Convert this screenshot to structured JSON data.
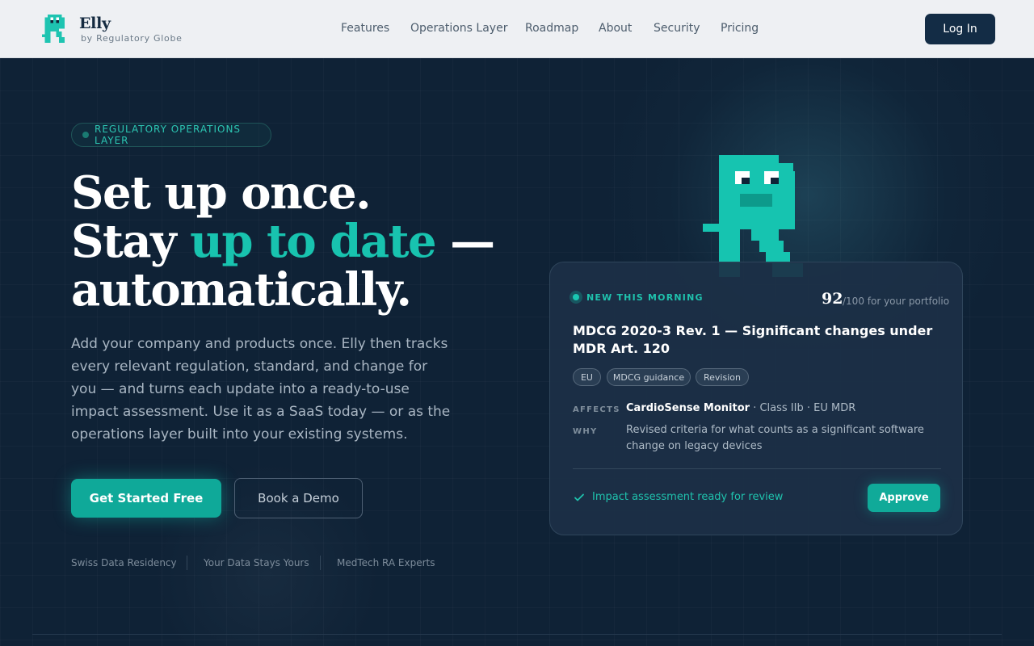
{
  "brand": {
    "name": "Elly",
    "tagline": "by Regulatory Globe",
    "accent_color": "#18c3af"
  },
  "nav": {
    "items": [
      "Features",
      "Operations Layer",
      "Roadmap",
      "About",
      "Security",
      "Pricing"
    ],
    "login_label": "Log In"
  },
  "hero": {
    "badge": "REGULATORY OPERATIONS LAYER",
    "headline_line1": "Set up once.",
    "headline_line2_pre": "Stay ",
    "headline_line2_accent": "up to date",
    "headline_line2_post": " —",
    "headline_line3": "automatically.",
    "lead": "Add your company and products once. Elly then tracks every relevant regulation, standard, and change for you — and turns each update into a ready-to-use impact assessment. Use it as a SaaS today — or as the operations layer built into your existing systems.",
    "cta_primary": "Get Started Free",
    "cta_secondary": "Book a Demo",
    "trust": [
      "Swiss Data Residency",
      "Your Data Stays Yours",
      "MedTech RA Experts"
    ]
  },
  "card": {
    "new_label": "NEW THIS MORNING",
    "score": "92",
    "score_suffix": "/100 for your portfolio",
    "title": "MDCG 2020-3 Rev. 1 — Significant changes under MDR Art. 120",
    "tags": [
      "EU",
      "MDCG guidance",
      "Revision"
    ],
    "affects_label": "AFFECTS",
    "affects_product": "CardioSense Monitor",
    "affects_detail": " · Class IIb · EU MDR",
    "why_label": "WHY",
    "why_text": "Revised criteria for what counts as a significant software change on legacy devices",
    "status": "Impact assessment ready for review",
    "approve_label": "Approve"
  }
}
